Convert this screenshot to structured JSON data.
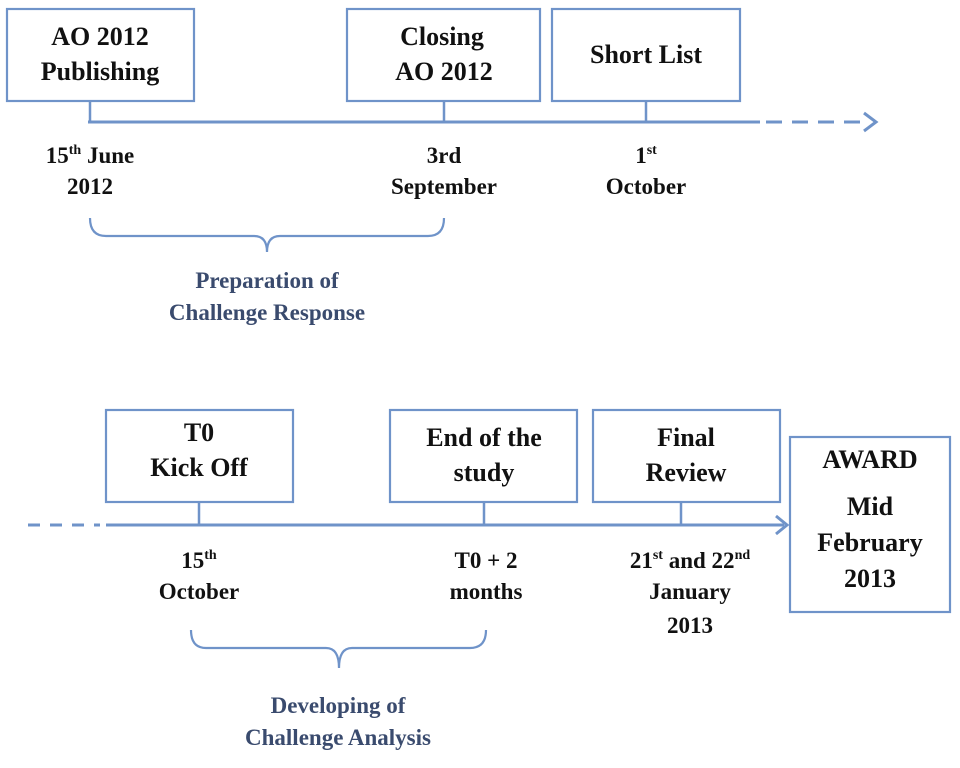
{
  "colors": {
    "line": "#6f93c9",
    "text": "#111111",
    "phase_label": "#3a4b6e"
  },
  "top": {
    "milestones": [
      {
        "title": [
          "AO 2012",
          "Publishing"
        ],
        "date": {
          "day": "15",
          "sup": "th",
          "rest": " June",
          "line2": "2012"
        }
      },
      {
        "title": [
          "Closing",
          "AO 2012"
        ],
        "date": {
          "day": "3rd",
          "line2": "September"
        }
      },
      {
        "title": [
          "Short List"
        ],
        "date": {
          "day": "1",
          "sup": "st",
          "line2": "October"
        }
      }
    ],
    "phase": [
      "Preparation of",
      "Challenge Response"
    ]
  },
  "bottom": {
    "milestones": [
      {
        "title": [
          "T0",
          "Kick Off"
        ],
        "date": {
          "day": "15",
          "sup": "th",
          "line2": "October"
        }
      },
      {
        "title": [
          "End of the",
          "study"
        ],
        "date": {
          "day": "T0 + 2",
          "line2": "months"
        }
      },
      {
        "title": [
          "Final",
          "Review"
        ],
        "date": {
          "a": "21",
          "a_sup": "st",
          "mid": " and 22",
          "b_sup": "nd",
          "line2": "January",
          "line3": "2013"
        }
      }
    ],
    "award": [
      "AWARD",
      "Mid",
      "February",
      "2013"
    ],
    "phase": [
      "Developing of",
      "Challenge Analysis"
    ]
  }
}
